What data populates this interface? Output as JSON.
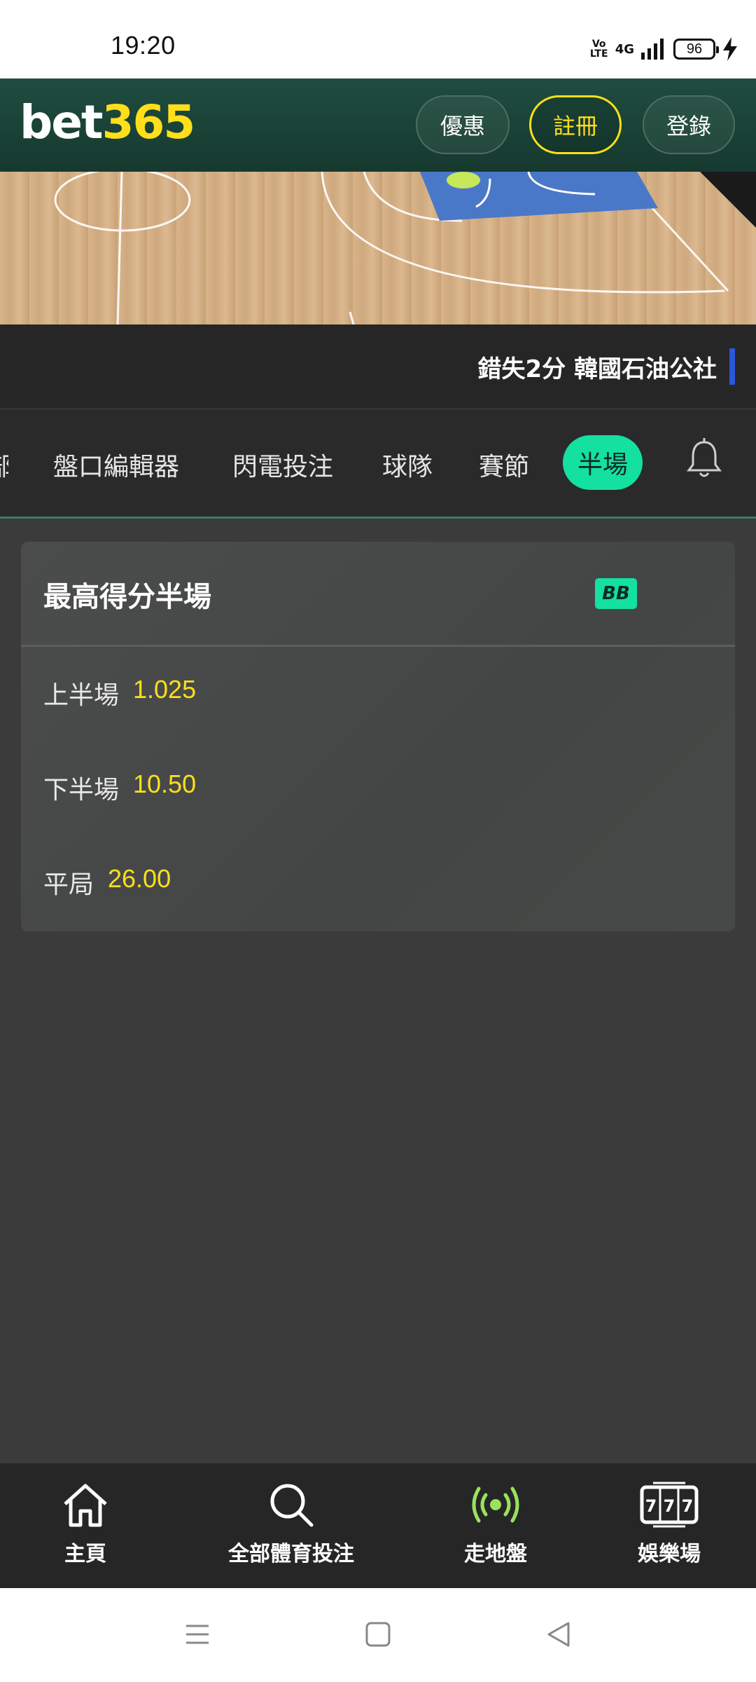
{
  "status_bar": {
    "time": "19:20",
    "volte": "Vo LTE",
    "network": "4G",
    "battery": "96",
    "icons": [
      "volte-icon",
      "signal-icon",
      "battery-icon",
      "charging-icon"
    ]
  },
  "header": {
    "logo_bet": "bet",
    "logo_365": "365",
    "promo_label": "優惠",
    "register_label": "註冊",
    "login_label": "登錄"
  },
  "score_strip": {
    "text": "錯失2分 韓國石油公社"
  },
  "tabs": {
    "items": [
      {
        "label": "部"
      },
      {
        "label": "盤口編輯器"
      },
      {
        "label": "閃電投注"
      },
      {
        "label": "球隊"
      },
      {
        "label": "賽節"
      },
      {
        "label": "半場"
      }
    ],
    "active": "半場",
    "bell_icon": "bell-icon"
  },
  "market": {
    "title": "最高得分半場",
    "badge": "BB",
    "selections": [
      {
        "name": "上半場",
        "odds": "1.025"
      },
      {
        "name": "下半場",
        "odds": "10.50"
      },
      {
        "name": "平局",
        "odds": "26.00"
      }
    ]
  },
  "bottom_nav": {
    "items": [
      {
        "label": "主頁",
        "icon": "home-icon"
      },
      {
        "label": "全部體育投注",
        "icon": "search-icon"
      },
      {
        "label": "走地盤",
        "icon": "live-icon"
      },
      {
        "label": "娛樂場",
        "icon": "casino-777-icon"
      }
    ]
  },
  "colors": {
    "brand_green": "#1f4d3f",
    "accent_yellow": "#ffdf1b",
    "accent_teal": "#14e0a0",
    "score_bar_blue": "#2a58d8"
  }
}
